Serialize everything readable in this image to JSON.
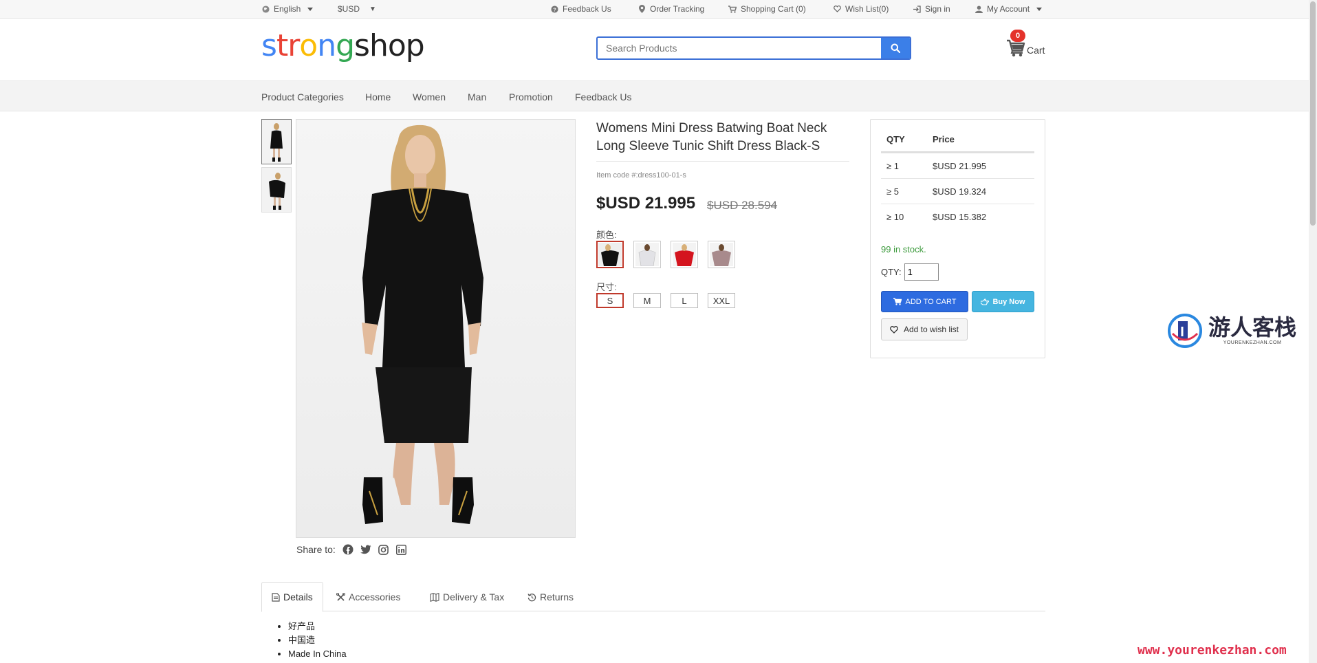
{
  "topbar": {
    "language": "English",
    "currency": "$USD",
    "feedback": "Feedback Us",
    "order_tracking": "Order Tracking",
    "shopping_cart": "Shopping Cart (0)",
    "wish_list": "Wish List(0)",
    "sign_in": "Sign in",
    "my_account": "My Account"
  },
  "header": {
    "logo": [
      "s",
      "t",
      "r",
      "o",
      "n",
      "g",
      "s",
      "h",
      "o",
      "p"
    ],
    "search_placeholder": "Search Products",
    "cart_count": "0",
    "cart_label": "Cart"
  },
  "nav": [
    "Product Categories",
    "Home",
    "Women",
    "Man",
    "Promotion",
    "Feedback Us"
  ],
  "product": {
    "title": "Womens Mini Dress Batwing Boat Neck Long Sleeve Tunic Shift Dress Black-S",
    "item_code": "Item code #:dress100-01-s",
    "price": "$USD 21.995",
    "old_price": "$USD 28.594",
    "color_label": "颜色:",
    "size_label": "尺寸:",
    "sizes": [
      "S",
      "M",
      "L",
      "XXL"
    ],
    "selected_size": "S",
    "share_label": "Share to:"
  },
  "pricing": {
    "qty_header": "QTY",
    "price_header": "Price",
    "rows": [
      {
        "qty": "≥  1",
        "price": "$USD 21.995"
      },
      {
        "qty": "≥  5",
        "price": "$USD 19.324"
      },
      {
        "qty": "≥  10",
        "price": "$USD 15.382"
      }
    ],
    "stock": "99 in stock.",
    "qty_label": "QTY:",
    "qty_value": "1",
    "add_to_cart": "ADD TO CART",
    "buy_now": "Buy Now",
    "wishlist": "Add to wish list"
  },
  "tabs": [
    "Details",
    "Accessories",
    "Delivery & Tax",
    "Returns"
  ],
  "details": [
    "好产品",
    "中国造",
    "Made In China"
  ],
  "watermark": {
    "title": "游人客栈",
    "sub": "YOURENKEZHAN.COM",
    "url": "www.yourenkezhan.com"
  },
  "colors": {
    "accent": "#2d6be0",
    "buy_now": "#45b5e0",
    "selected_border": "#c0392b",
    "stock_green": "#3c9a3c",
    "badge_red": "#e4322b"
  }
}
